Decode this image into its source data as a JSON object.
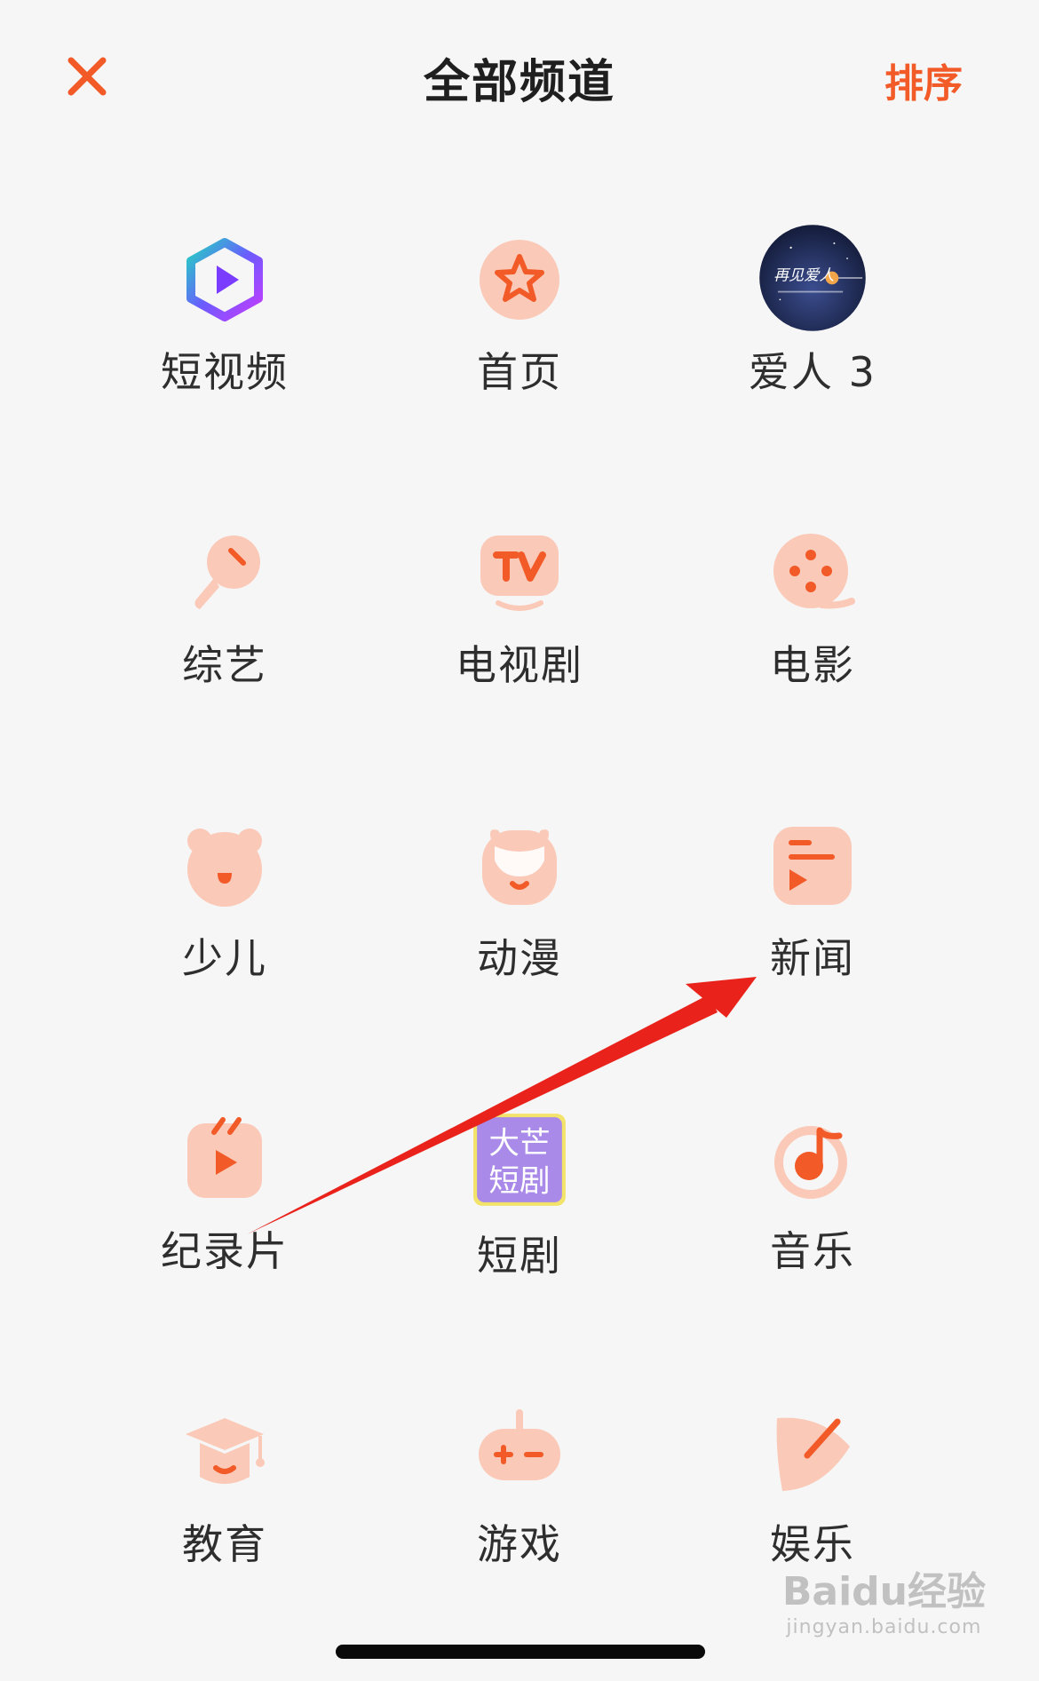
{
  "header": {
    "title": "全部频道",
    "sort_label": "排序"
  },
  "channels": [
    {
      "label": "短视频",
      "icon": "short-video-icon"
    },
    {
      "label": "首页",
      "icon": "star-icon"
    },
    {
      "label": "爱人 3",
      "icon": "poster-thumbnail"
    },
    {
      "label": "综艺",
      "icon": "microphone-icon"
    },
    {
      "label": "电视剧",
      "icon": "tv-icon"
    },
    {
      "label": "电影",
      "icon": "film-reel-icon"
    },
    {
      "label": "少儿",
      "icon": "bear-icon"
    },
    {
      "label": "动漫",
      "icon": "anime-face-icon"
    },
    {
      "label": "新闻",
      "icon": "news-icon"
    },
    {
      "label": "纪录片",
      "icon": "clapper-icon"
    },
    {
      "label": "短剧",
      "icon": "short-drama-badge"
    },
    {
      "label": "音乐",
      "icon": "music-note-icon"
    },
    {
      "label": "教育",
      "icon": "graduation-cap-icon"
    },
    {
      "label": "游戏",
      "icon": "gamepad-icon"
    },
    {
      "label": "娱乐",
      "icon": "leaf-pen-icon"
    }
  ],
  "thumbnail": {
    "poster_text": "再见爱人"
  },
  "badge": {
    "line1": "大芒",
    "line2": "短剧"
  },
  "watermark": {
    "main": "Baidu经验",
    "sub": "jingyan.baidu.com"
  },
  "colors": {
    "accent": "#f25a28",
    "icon_bg": "#fbc9b7",
    "text": "#2e2e2e"
  }
}
